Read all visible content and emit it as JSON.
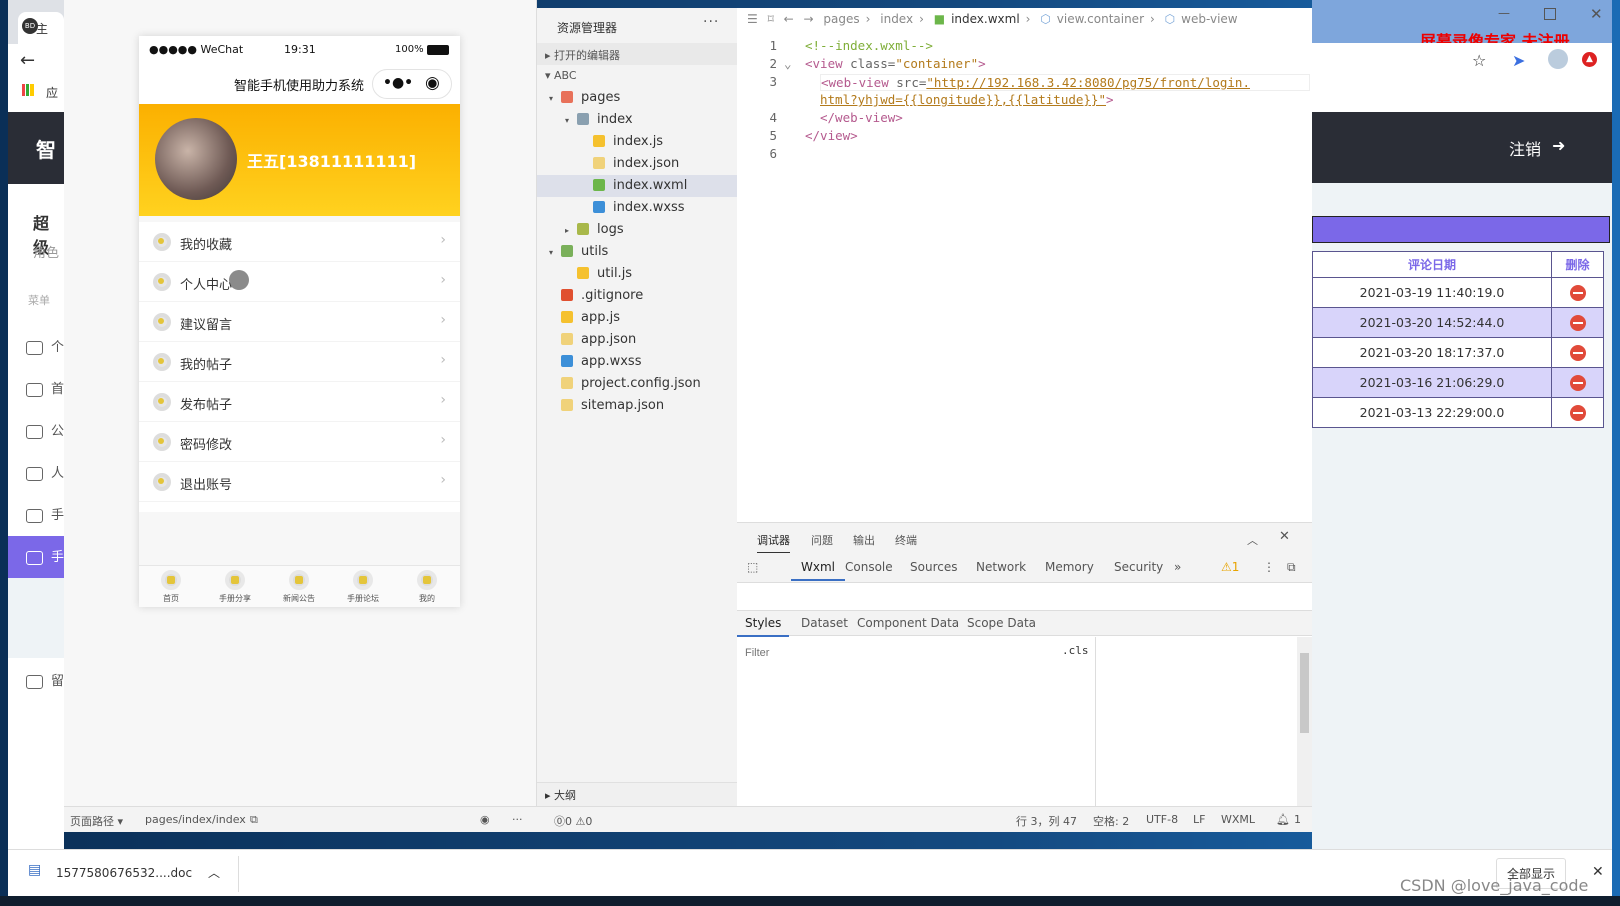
{
  "left_browser": {
    "tab_label": "主",
    "apps_label": "应",
    "header": "智",
    "user": "超级",
    "role": "角色",
    "menu_label": "菜单",
    "menu_items": [
      "个",
      "首",
      "公",
      "人",
      "手",
      "手",
      "留"
    ]
  },
  "simulator": {
    "status": {
      "carrier": "●●●●● WeChat",
      "time": "19:31",
      "battery": "100%"
    },
    "nav_title": "智能手机使用助力系统",
    "capsule_more": "•●•",
    "capsule_close": "◉",
    "user_name": "王五[13811111111]",
    "menu": [
      {
        "label": "我的收藏",
        "icon": "star-icon"
      },
      {
        "label": "个人中心",
        "icon": "location-icon"
      },
      {
        "label": "建议留言",
        "icon": "gift-icon"
      },
      {
        "label": "我的帖子",
        "icon": "gift-icon"
      },
      {
        "label": "发布帖子",
        "icon": "gift-icon"
      },
      {
        "label": "密码修改",
        "icon": "flower-icon"
      },
      {
        "label": "退出账号",
        "icon": "bell-icon"
      }
    ],
    "tabbar": [
      "首页",
      "手册分享",
      "新闻公告",
      "手册论坛",
      "我的"
    ],
    "path_label": "页面路径 ▾",
    "path": "pages/index/index"
  },
  "explorer": {
    "title": "资源管理器",
    "more": "···",
    "open_editors": "打开的编辑器",
    "project": "ABC",
    "outline": "大纲",
    "tree": [
      {
        "name": "pages",
        "depth": 1,
        "arrow": "▾",
        "color": "#e8715a"
      },
      {
        "name": "index",
        "depth": 2,
        "arrow": "▾",
        "color": "#8aa0b0"
      },
      {
        "name": "index.js",
        "depth": 3,
        "arrow": "",
        "color": "#f5c12e"
      },
      {
        "name": "index.json",
        "depth": 3,
        "arrow": "",
        "color": "#f0d27a"
      },
      {
        "name": "index.wxml",
        "depth": 3,
        "arrow": "",
        "color": "#6cb64a",
        "selected": true
      },
      {
        "name": "index.wxss",
        "depth": 3,
        "arrow": "",
        "color": "#3c8fd8"
      },
      {
        "name": "logs",
        "depth": 2,
        "arrow": "▸",
        "color": "#a8b84a"
      },
      {
        "name": "utils",
        "depth": 1,
        "arrow": "▾",
        "color": "#7ab05a"
      },
      {
        "name": "util.js",
        "depth": 2,
        "arrow": "",
        "color": "#f5c12e"
      },
      {
        "name": ".gitignore",
        "depth": 1,
        "arrow": "",
        "color": "#e0502f"
      },
      {
        "name": "app.js",
        "depth": 1,
        "arrow": "",
        "color": "#f5c12e"
      },
      {
        "name": "app.json",
        "depth": 1,
        "arrow": "",
        "color": "#f0d27a"
      },
      {
        "name": "app.wxss",
        "depth": 1,
        "arrow": "",
        "color": "#3c8fd8"
      },
      {
        "name": "project.config.json",
        "depth": 1,
        "arrow": "",
        "color": "#f0d27a"
      },
      {
        "name": "sitemap.json",
        "depth": 1,
        "arrow": "",
        "color": "#f0d27a"
      }
    ]
  },
  "editor": {
    "breadcrumb": [
      "pages",
      "index",
      "index.wxml",
      "view.container",
      "web-view"
    ],
    "lines": {
      "n1": "1",
      "n2": "2",
      "n3": "3",
      "n4": "4",
      "n5": "5",
      "n6": "6",
      "l1": "<!--index.wxml-->",
      "l2a": "<view ",
      "l2b": "class=",
      "l2c": "\"container\"",
      "l2d": ">",
      "l3a": "<web-view ",
      "l3b": "src=",
      "l3c": "\"http://192.168.3.42:8080/pg75/front/login.",
      "l3d": "html?yhjwd={{longitude}},{{latitude}}\"",
      "l3e": ">",
      "l4": "</web-view>",
      "l5": "</view>"
    }
  },
  "devtools": {
    "top_tabs": [
      "调试器",
      "问题",
      "输出",
      "终端"
    ],
    "tabs": [
      "Wxml",
      "Console",
      "Sources",
      "Network",
      "Memory",
      "Security"
    ],
    "more": "»",
    "warnings": "⚠1",
    "style_tabs": [
      "Styles",
      "Dataset",
      "Component Data",
      "Scope Data"
    ],
    "filter_placeholder": "Filter",
    "cls": ".cls"
  },
  "statusbar": {
    "errors": "⓪0 ⚠0",
    "position": "行 3，列 47",
    "spaces": "空格: 2",
    "encoding": "UTF-8",
    "eol": "LF",
    "lang": "WXML",
    "notifications": "1"
  },
  "right_browser": {
    "watermark": "屏幕录像专家  未注册",
    "logout": "注销",
    "table": {
      "headers": [
        "评论日期",
        "删除"
      ],
      "rows": [
        "2021-03-19 11:40:19.0",
        "2021-03-20 14:52:44.0",
        "2021-03-20 18:17:37.0",
        "2021-03-16 21:06:29.0",
        "2021-03-13 22:29:00.0"
      ]
    }
  },
  "download": {
    "file": "1577580676532....doc",
    "show_all": "全部显示",
    "credit": "CSDN @love_java_code"
  },
  "colors": {
    "accent": "#7b68e8",
    "delete": "#e14a3a",
    "header_dark": "#2a2d36",
    "banner": "#fbb000"
  }
}
